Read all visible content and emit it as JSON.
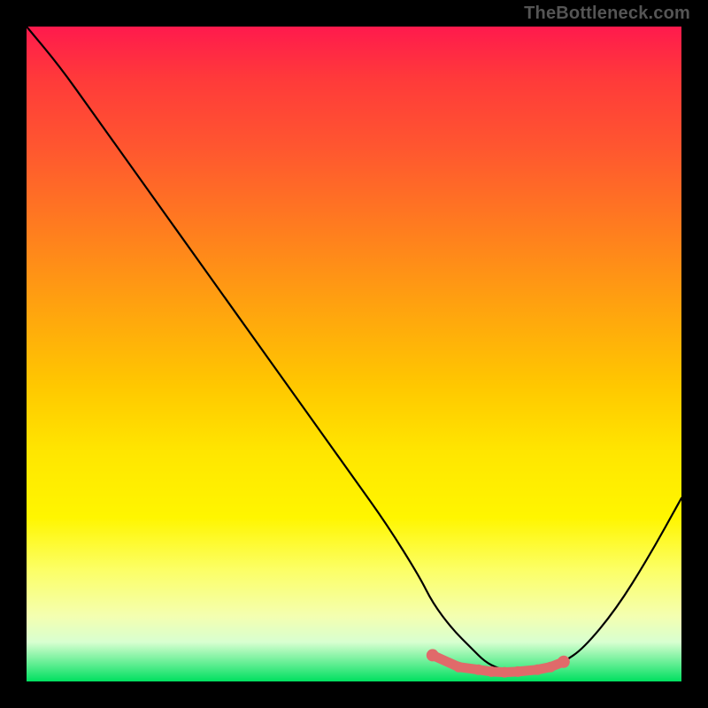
{
  "watermark": "TheBottleneck.com",
  "chart_data": {
    "type": "line",
    "title": "",
    "xlabel": "",
    "ylabel": "",
    "xlim": [
      0,
      100
    ],
    "ylim": [
      0,
      100
    ],
    "series": [
      {
        "name": "bottleneck-curve",
        "x": [
          0,
          5,
          10,
          15,
          20,
          25,
          30,
          35,
          40,
          45,
          50,
          55,
          60,
          62,
          65,
          68,
          70,
          72,
          74,
          76,
          78,
          80,
          82,
          85,
          90,
          95,
          100
        ],
        "values": [
          100,
          94,
          87,
          80,
          73,
          66,
          59,
          52,
          45,
          38,
          31,
          24,
          16,
          12,
          8,
          5,
          3,
          2,
          1.5,
          1.2,
          1.3,
          1.8,
          3,
          5,
          11,
          19,
          28
        ]
      }
    ],
    "markers": {
      "name": "highlight-points",
      "color": "#e06a6a",
      "points": [
        {
          "x": 62,
          "y": 4
        },
        {
          "x": 66,
          "y": 2.2
        },
        {
          "x": 69,
          "y": 1.8
        },
        {
          "x": 71,
          "y": 1.5
        },
        {
          "x": 73,
          "y": 1.4
        },
        {
          "x": 75,
          "y": 1.5
        },
        {
          "x": 78,
          "y": 1.8
        },
        {
          "x": 80,
          "y": 2.2
        },
        {
          "x": 82,
          "y": 3
        }
      ]
    },
    "gradient_stops": [
      {
        "pos": 0,
        "color": "#ff1a4d"
      },
      {
        "pos": 30,
        "color": "#ff7a20"
      },
      {
        "pos": 60,
        "color": "#ffe600"
      },
      {
        "pos": 90,
        "color": "#f4ffb0"
      },
      {
        "pos": 100,
        "color": "#00e060"
      }
    ]
  }
}
